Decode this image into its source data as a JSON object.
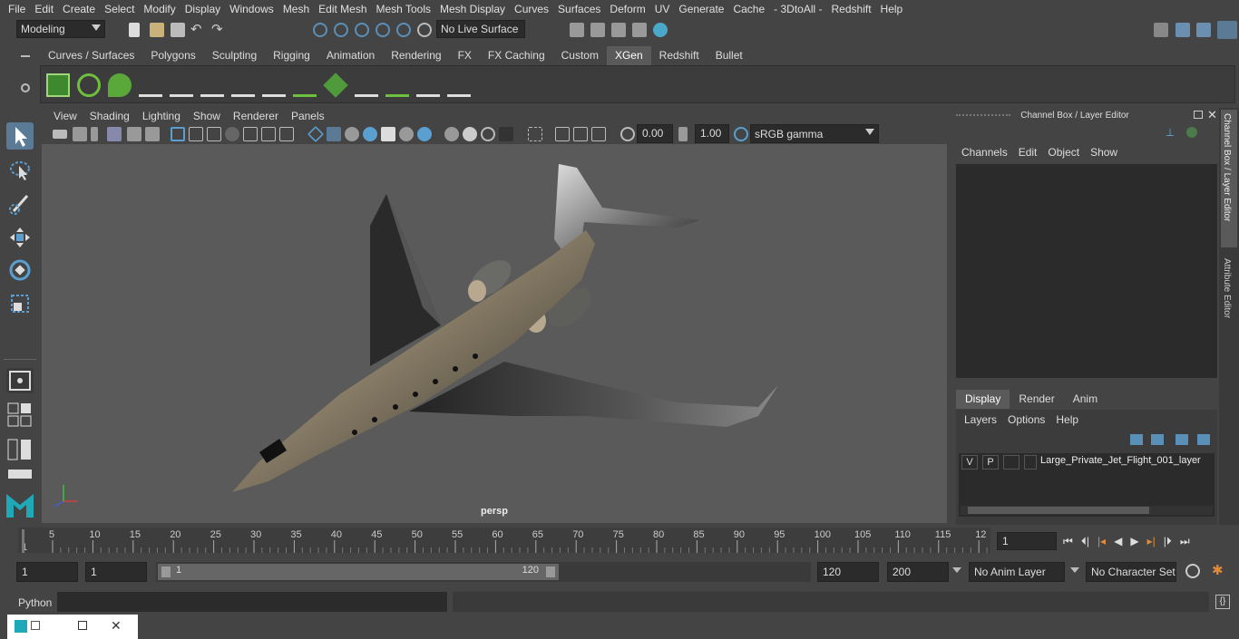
{
  "menubar": [
    "File",
    "Edit",
    "Create",
    "Select",
    "Modify",
    "Display",
    "Windows",
    "Mesh",
    "Edit Mesh",
    "Mesh Tools",
    "Mesh Display",
    "Curves",
    "Surfaces",
    "Deform",
    "UV",
    "Generate",
    "Cache",
    "- 3DtoAll -",
    "Redshift",
    "Help"
  ],
  "status": {
    "mode": "Modeling",
    "live_surface": "No Live Surface"
  },
  "shelf_tabs": [
    "Curves / Surfaces",
    "Polygons",
    "Sculpting",
    "Rigging",
    "Animation",
    "Rendering",
    "FX",
    "FX Caching",
    "Custom",
    "XGen",
    "Redshift",
    "Bullet"
  ],
  "shelf_active": "XGen",
  "viewport": {
    "menu": [
      "View",
      "Shading",
      "Lighting",
      "Show",
      "Renderer",
      "Panels"
    ],
    "exposure": "0.00",
    "gamma": "1.00",
    "color_space": "sRGB gamma",
    "camera_label": "persp"
  },
  "channel_box": {
    "title": "Channel Box / Layer Editor",
    "menu": [
      "Channels",
      "Edit",
      "Object",
      "Show"
    ],
    "tabs": [
      "Display",
      "Render",
      "Anim"
    ],
    "active_tab": "Display",
    "layer_menu": [
      "Layers",
      "Options",
      "Help"
    ],
    "layer": {
      "v": "V",
      "p": "P",
      "name": "Large_Private_Jet_Flight_001_layer"
    }
  },
  "side_tabs": [
    "Channel Box / Layer Editor",
    "Attribute Editor"
  ],
  "timeline": {
    "ticks": [
      "1",
      "5",
      "10",
      "15",
      "20",
      "25",
      "30",
      "35",
      "40",
      "45",
      "50",
      "55",
      "60",
      "65",
      "70",
      "75",
      "80",
      "85",
      "90",
      "95",
      "100",
      "105",
      "110",
      "115",
      "12"
    ],
    "current_frame": "1"
  },
  "range": {
    "start": "1",
    "start2": "1",
    "slider_start": "1",
    "slider_end": "120",
    "end": "120",
    "end2": "200",
    "anim_layer": "No Anim Layer",
    "char_set": "No Character Set"
  },
  "cmd": {
    "label": "Python"
  },
  "colors": {
    "bg": "#444444",
    "viewport": "#5a5a5a",
    "accent": "#5285a6",
    "active_tab": "#5a5a5a"
  }
}
